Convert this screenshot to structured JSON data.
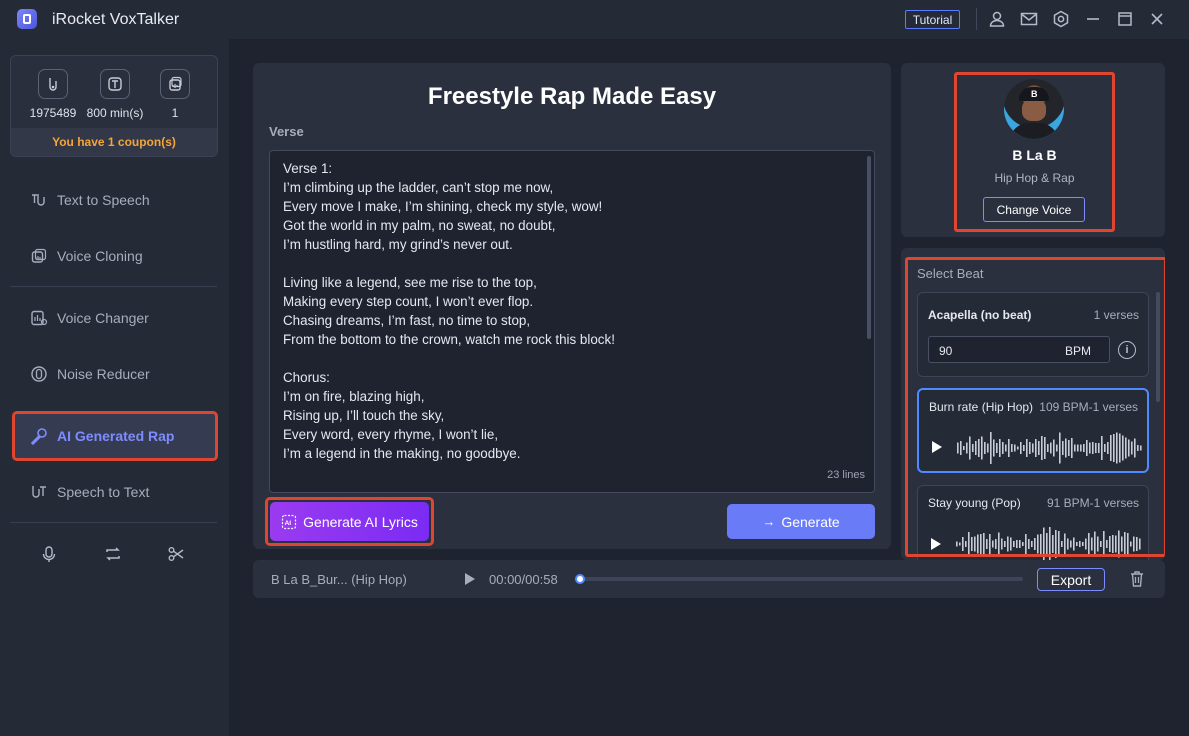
{
  "app": {
    "title": "iRocket VoxTalker",
    "tutorial_label": "Tutorial",
    "toolbar_icons": [
      "user-icon",
      "mail-icon",
      "settings-icon",
      "minimize-icon",
      "maximize-icon",
      "close-icon"
    ]
  },
  "sidebar": {
    "stats": [
      {
        "icon": "characters-icon",
        "value": "1975489"
      },
      {
        "icon": "minutes-icon",
        "value": "800 min(s)"
      },
      {
        "icon": "voice-clone-count-icon",
        "value": "1"
      }
    ],
    "coupon_text": "You have 1 coupon(s)",
    "nav": [
      {
        "label": "Text to Speech",
        "icon": "text-to-speech-icon",
        "active": false
      },
      {
        "label": "Voice Cloning",
        "icon": "voice-cloning-icon",
        "active": false
      },
      {
        "label": "Voice Changer",
        "icon": "voice-changer-icon",
        "active": false
      },
      {
        "label": "Noise Reducer",
        "icon": "noise-reducer-icon",
        "active": false
      },
      {
        "label": "AI Generated Rap",
        "icon": "microphone-icon",
        "active": true
      },
      {
        "label": "Speech to Text",
        "icon": "speech-to-text-icon",
        "active": false
      }
    ],
    "bottom_tools": [
      "record-icon",
      "convert-icon",
      "cut-icon"
    ]
  },
  "editor": {
    "title": "Freestyle Rap Made Easy",
    "verse_label": "Verse",
    "lyrics": "Verse 1:\nI’m climbing up the ladder, can’t stop me now,\nEvery move I make, I’m shining, check my style, wow!\nGot the world in my palm, no sweat, no doubt,\nI’m hustling hard, my grind’s never out.\n\nLiving like a legend, see me rise to the top,\nMaking every step count, I won’t ever flop.\nChasing dreams, I’m fast, no time to stop,\nFrom the bottom to the crown, watch me rock this block!\n\nChorus:\nI’m on fire, blazing high,\nRising up, I’ll touch the sky,\nEvery word, every rhyme, I won’t lie,\nI’m a legend in the making, no goodbye.",
    "line_count": "23 lines",
    "generate_lyrics_label": "Generate AI Lyrics",
    "generate_label": "Generate"
  },
  "voice": {
    "name": "B La B",
    "genre": "Hip Hop & Rap",
    "change_label": "Change Voice"
  },
  "beats": {
    "label": "Select Beat",
    "items": [
      {
        "name": "Acapella (no beat)",
        "meta": "1 verses",
        "bpm_value": "90",
        "bpm_unit": "BPM"
      },
      {
        "name": "Burn rate (Hip Hop)",
        "meta": "109 BPM-1 verses",
        "selected": true
      },
      {
        "name": "Stay young (Pop)",
        "meta": "91 BPM-1 verses"
      }
    ]
  },
  "player": {
    "track": "B La B_Bur... (Hip Hop)",
    "time": "00:00/00:58",
    "progress": 0,
    "export_label": "Export"
  },
  "colors": {
    "accent": "#6a7bf8",
    "highlight": "#e0452f",
    "coupon": "#f5a53a",
    "purple": "#8a34f2"
  }
}
